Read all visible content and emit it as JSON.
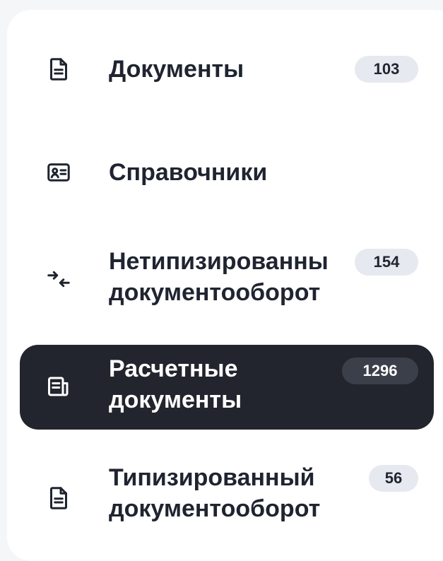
{
  "nav": {
    "items": [
      {
        "label": "Документы",
        "badge": "103",
        "icon": "document-icon",
        "active": false
      },
      {
        "label": "Справочники",
        "badge": "",
        "icon": "contact-card-icon",
        "active": false
      },
      {
        "label": "Нетипизированны\nдокументооборот",
        "badge": "154",
        "icon": "arrows-exchange-icon",
        "active": false
      },
      {
        "label": "Расчетные\nдокументы",
        "badge": "1296",
        "icon": "receipt-icon",
        "active": true
      },
      {
        "label": "Типизированный\nдокументооборот",
        "badge": "56",
        "icon": "document-icon",
        "active": false
      }
    ]
  },
  "colors": {
    "active_background": "#22252d",
    "badge_background": "#e6e9ef",
    "active_badge_background": "#3b3f49"
  }
}
